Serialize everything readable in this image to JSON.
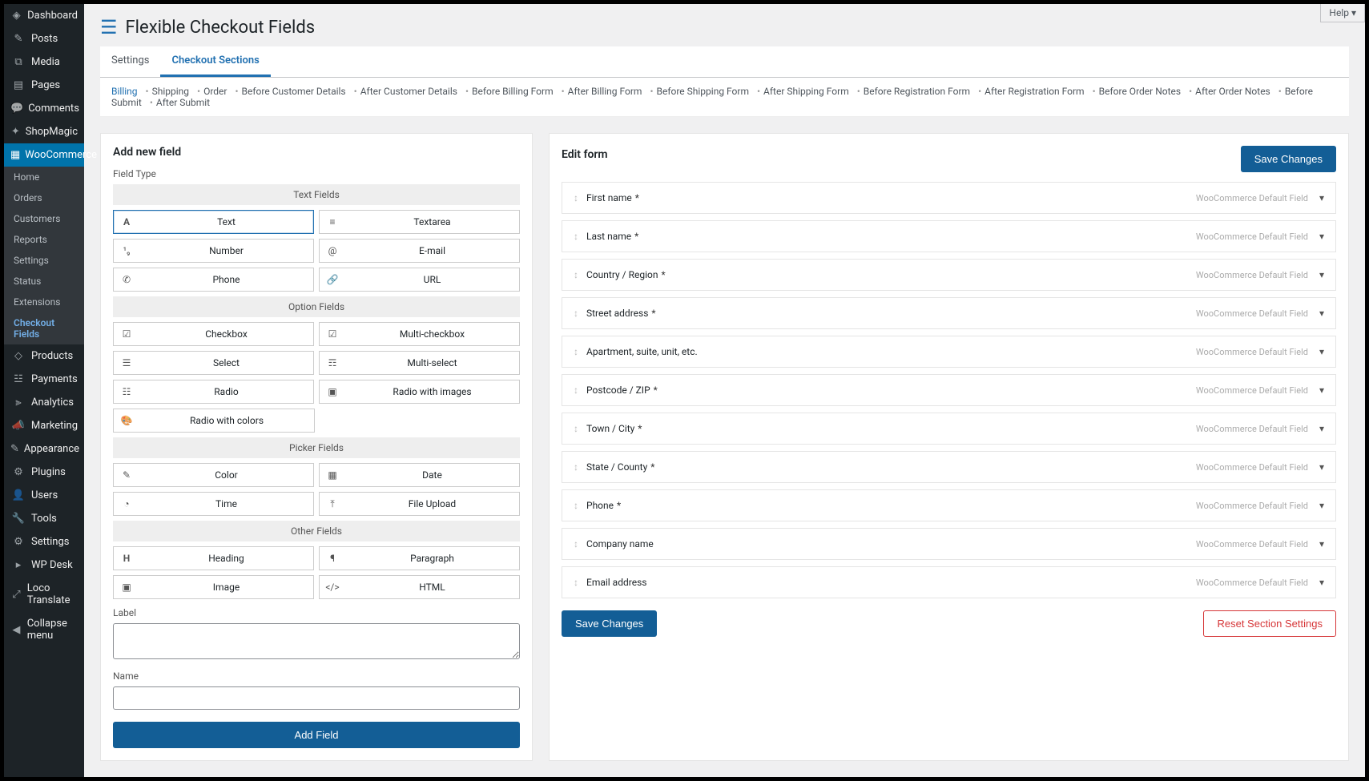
{
  "help": "Help ▾",
  "page_title": "Flexible Checkout Fields",
  "sidebar": {
    "items": [
      {
        "icon": "◈",
        "label": "Dashboard"
      },
      {
        "icon": "✎",
        "label": "Posts"
      },
      {
        "icon": "⧉",
        "label": "Media"
      },
      {
        "icon": "▤",
        "label": "Pages"
      },
      {
        "icon": "💬",
        "label": "Comments"
      },
      {
        "icon": "✦",
        "label": "ShopMagic"
      }
    ],
    "wc_label": "WooCommerce",
    "sub": [
      {
        "label": "Home"
      },
      {
        "label": "Orders"
      },
      {
        "label": "Customers"
      },
      {
        "label": "Reports"
      },
      {
        "label": "Settings"
      },
      {
        "label": "Status"
      },
      {
        "label": "Extensions"
      },
      {
        "label": "Checkout Fields",
        "active": true
      }
    ],
    "items2": [
      {
        "icon": "◇",
        "label": "Products"
      },
      {
        "icon": "☳",
        "label": "Payments"
      },
      {
        "icon": "⫸",
        "label": "Analytics"
      },
      {
        "icon": "📣",
        "label": "Marketing"
      },
      {
        "icon": "✎",
        "label": "Appearance"
      },
      {
        "icon": "⚙",
        "label": "Plugins"
      },
      {
        "icon": "👤",
        "label": "Users"
      },
      {
        "icon": "🔧",
        "label": "Tools"
      },
      {
        "icon": "⚙",
        "label": "Settings"
      },
      {
        "icon": "▸",
        "label": "WP Desk"
      },
      {
        "icon": "⤢",
        "label": "Loco Translate"
      },
      {
        "icon": "◀",
        "label": "Collapse menu"
      }
    ]
  },
  "tabs": [
    {
      "label": "Settings",
      "active": false
    },
    {
      "label": "Checkout Sections",
      "active": true
    }
  ],
  "subtabs": [
    "Billing",
    "Shipping",
    "Order",
    "Before Customer Details",
    "After Customer Details",
    "Before Billing Form",
    "After Billing Form",
    "Before Shipping Form",
    "After Shipping Form",
    "Before Registration Form",
    "After Registration Form",
    "Before Order Notes",
    "After Order Notes",
    "Before Submit",
    "After Submit"
  ],
  "left": {
    "title": "Add new field",
    "fieldtype_label": "Field Type",
    "groups": {
      "text": "Text Fields",
      "option": "Option Fields",
      "picker": "Picker Fields",
      "other": "Other Fields"
    },
    "types": {
      "text": "Text",
      "textarea": "Textarea",
      "number": "Number",
      "email": "E-mail",
      "phone": "Phone",
      "url": "URL",
      "checkbox": "Checkbox",
      "multicheckbox": "Multi-checkbox",
      "select": "Select",
      "multiselect": "Multi-select",
      "radio": "Radio",
      "radioimg": "Radio with images",
      "radiocolor": "Radio with colors",
      "color": "Color",
      "date": "Date",
      "time": "Time",
      "file": "File Upload",
      "heading": "Heading",
      "paragraph": "Paragraph",
      "image": "Image",
      "html": "HTML"
    },
    "label_label": "Label",
    "name_label": "Name",
    "add_button": "Add Field"
  },
  "right": {
    "title": "Edit form",
    "save": "Save Changes",
    "default_tag": "WooCommerce Default Field",
    "fields": [
      {
        "label": "First name",
        "req": true
      },
      {
        "label": "Last name",
        "req": true
      },
      {
        "label": "Country / Region",
        "req": true
      },
      {
        "label": "Street address",
        "req": true
      },
      {
        "label": "Apartment, suite, unit, etc.",
        "req": false
      },
      {
        "label": "Postcode / ZIP",
        "req": true
      },
      {
        "label": "Town / City",
        "req": true
      },
      {
        "label": "State / County",
        "req": true
      },
      {
        "label": "Phone",
        "req": true
      },
      {
        "label": "Company name",
        "req": false
      },
      {
        "label": "Email address",
        "req": false
      }
    ],
    "reset": "Reset Section Settings"
  }
}
